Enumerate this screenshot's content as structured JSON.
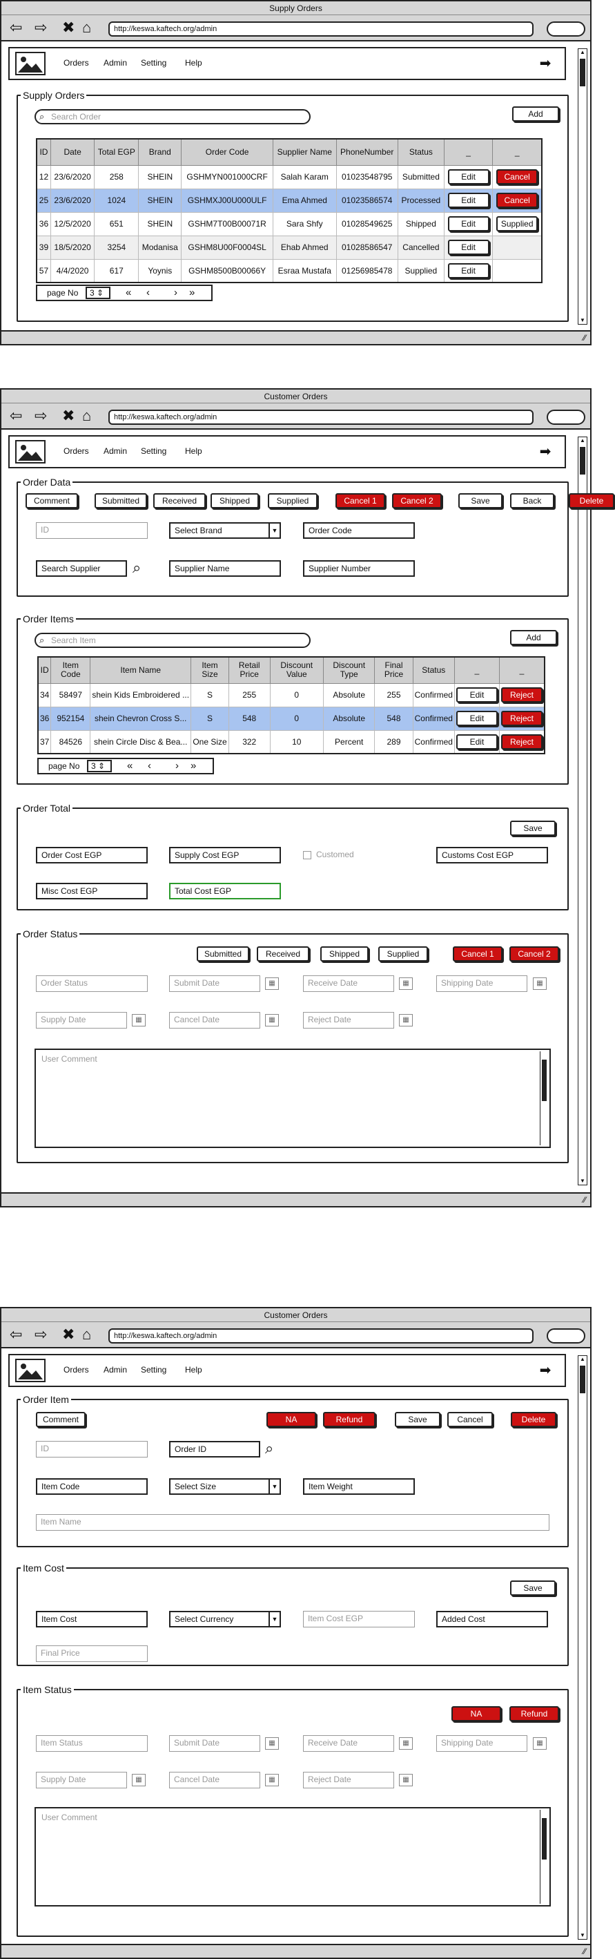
{
  "browser": {
    "url": "http://keswa.kaftech.org/admin"
  },
  "menu": {
    "orders": "Orders",
    "admin": "Admin",
    "setting": "Setting",
    "help": "Help"
  },
  "win1": {
    "title": "Supply Orders",
    "section_title": "Supply Orders",
    "search_placeholder": "Search Order",
    "add_label": "Add",
    "columns": [
      "ID",
      "Date",
      "Total EGP",
      "Brand",
      "Order Code",
      "Supplier Name",
      "PhoneNumber",
      "Status",
      "_",
      "_"
    ],
    "rows": [
      {
        "id": "12",
        "date": "23/6/2020",
        "total": "258",
        "brand": "SHEIN",
        "code": "GSHMYN001000CRF",
        "supplier": "Salah Karam",
        "phone": "01023548795",
        "status": "Submitted",
        "edit": "Edit",
        "action": "Cancel"
      },
      {
        "id": "25",
        "date": "23/6/2020",
        "total": "1024",
        "brand": "SHEIN",
        "code": "GSHMXJ00U000ULF",
        "supplier": "Ema Ahmed",
        "phone": "01023586574",
        "status": "Processed",
        "edit": "Edit",
        "action": "Cancel"
      },
      {
        "id": "36",
        "date": "12/5/2020",
        "total": "651",
        "brand": "SHEIN",
        "code": "GSHM7T00B00071R",
        "supplier": "Sara Shfy",
        "phone": "01028549625",
        "status": "Shipped",
        "edit": "Edit",
        "action": "Supplied"
      },
      {
        "id": "39",
        "date": "18/5/2020",
        "total": "3254",
        "brand": "Modanisa",
        "code": "GSHM8U00F0004SL",
        "supplier": "Ehab Ahmed",
        "phone": "01028586547",
        "status": "Cancelled",
        "edit": "Edit",
        "action": ""
      },
      {
        "id": "57",
        "date": "4/4/2020",
        "total": "617",
        "brand": "Yoynis",
        "code": "GSHM8500B00066Y",
        "supplier": "Esraa Mustafa",
        "phone": "01256985478",
        "status": "Supplied",
        "edit": "Edit",
        "action": ""
      }
    ],
    "pager": {
      "label": "page No",
      "page": "3",
      "first": "«",
      "prev": "‹",
      "next": "›",
      "last": "»"
    }
  },
  "win2": {
    "title": "Customer Orders",
    "order_data": {
      "legend": "Order Data",
      "buttons": [
        "Comment",
        "Submitted",
        "Received",
        "Shipped",
        "Supplied"
      ],
      "cancel1": "Cancel 1",
      "cancel2": "Cancel 2",
      "save": "Save",
      "back": "Back",
      "delete": "Delete",
      "id_placeholder": "ID",
      "brand_select": "Select Brand",
      "order_code": "Order Code",
      "search_supplier": "Search Supplier",
      "supplier_name": "Supplier Name",
      "supplier_number": "Supplier Number"
    },
    "order_items": {
      "legend": "Order Items",
      "search_placeholder": "Search Item",
      "add_label": "Add",
      "columns": [
        "ID",
        "Item Code",
        "Item Name",
        "Item Size",
        "Retail Price",
        "Discount Value",
        "Discount Type",
        "Final Price",
        "Status",
        "_",
        "_"
      ],
      "rows": [
        {
          "id": "34",
          "code": "58497",
          "name": "shein Kids Embroidered ...",
          "size": "S",
          "retail": "255",
          "discount": "0",
          "dtype": "Absolute",
          "final": "255",
          "status": "Confirmed",
          "edit": "Edit",
          "action": "Reject"
        },
        {
          "id": "36",
          "code": "952154",
          "name": "shein Chevron Cross S...",
          "size": "S",
          "retail": "548",
          "discount": "0",
          "dtype": "Absolute",
          "final": "548",
          "status": "Confirmed",
          "edit": "Edit",
          "action": "Reject"
        },
        {
          "id": "37",
          "code": "84526",
          "name": "shein Circle Disc & Bea...",
          "size": "One Size",
          "retail": "322",
          "discount": "10",
          "dtype": "Percent",
          "final": "289",
          "status": "Confirmed",
          "edit": "Edit",
          "action": "Reject"
        }
      ],
      "pager": {
        "label": "page No",
        "page": "3",
        "first": "«",
        "prev": "‹",
        "next": "›",
        "last": "»"
      }
    },
    "order_total": {
      "legend": "Order Total",
      "save": "Save",
      "order_cost": "Order Cost EGP",
      "supply_cost": "Supply Cost EGP",
      "customed": "Customed",
      "customs_cost": "Customs Cost EGP",
      "misc_cost": "Misc Cost EGP",
      "total_cost": "Total Cost EGP"
    },
    "order_status": {
      "legend": "Order Status",
      "buttons": [
        "Submitted",
        "Received",
        "Shipped",
        "Supplied"
      ],
      "cancel1": "Cancel 1",
      "cancel2": "Cancel 2",
      "order_status": "Order Status",
      "submit_date": "Submit Date",
      "receive_date": "Receive Date",
      "shipping_date": "Shipping Date",
      "supply_date": "Supply Date",
      "cancel_date": "Cancel Date",
      "reject_date": "Reject Date",
      "user_comment": "User Comment"
    }
  },
  "win3": {
    "title": "Customer Orders",
    "order_item": {
      "legend": "Order Item",
      "comment": "Comment",
      "na": "NA",
      "refund": "Refund",
      "save": "Save",
      "cancel": "Cancel",
      "delete": "Delete",
      "id_placeholder": "ID",
      "order_id": "Order ID",
      "item_code": "Item Code",
      "size_select": "Select Size",
      "item_weight": "Item Weight",
      "item_name": "Item Name"
    },
    "item_cost": {
      "legend": "Item Cost",
      "save": "Save",
      "item_cost": "Item Cost",
      "currency_select": "Select Currency",
      "item_cost_egp": "Item Cost EGP",
      "added_cost": "Added Cost",
      "final_price": "Final Price"
    },
    "item_status": {
      "legend": "Item Status",
      "na": "NA",
      "refund": "Refund",
      "item_status": "Item Status",
      "submit_date": "Submit Date",
      "receive_date": "Receive Date",
      "shipping_date": "Shipping Date",
      "supply_date": "Supply Date",
      "cancel_date": "Cancel Date",
      "reject_date": "Reject Date",
      "user_comment": "User Comment"
    }
  }
}
